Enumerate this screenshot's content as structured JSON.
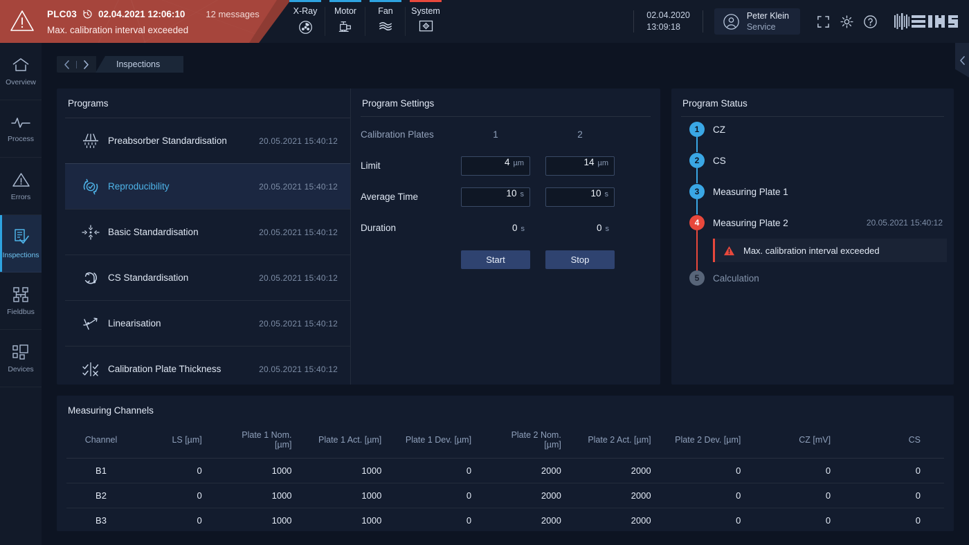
{
  "alarm": {
    "plc": "PLC03",
    "datetime": "02.04.2021 12:06:10",
    "messages": "12 messages",
    "text": "Max. calibration interval exceeded"
  },
  "status_tabs": [
    {
      "label": "X-Ray",
      "icon": "radiation-icon",
      "state_color": "#2ea3e0"
    },
    {
      "label": "Motor",
      "icon": "motor-icon",
      "state_color": "#2ea3e0"
    },
    {
      "label": "Fan",
      "icon": "fan-icon",
      "state_color": "#2ea3e0"
    },
    {
      "label": "System",
      "icon": "system-gear-icon",
      "state_color": "#e8483c"
    }
  ],
  "header": {
    "date": "02.04.2020",
    "time": "13:09:18",
    "user_name": "Peter Klein",
    "user_role": "Service",
    "fullscreen_icon": "fullscreen-icon",
    "settings_icon": "gear-icon",
    "help_icon": "help-icon",
    "logo": "IMS"
  },
  "sidebar": {
    "items": [
      {
        "label": "Overview",
        "icon": "home-icon",
        "active": false
      },
      {
        "label": "Process",
        "icon": "pulse-icon",
        "active": false
      },
      {
        "label": "Errors",
        "icon": "warning-icon",
        "active": false
      },
      {
        "label": "Inspections",
        "icon": "checklist-icon",
        "active": true
      },
      {
        "label": "Fieldbus",
        "icon": "network-icon",
        "active": false
      },
      {
        "label": "Devices",
        "icon": "devices-icon",
        "active": false
      }
    ]
  },
  "breadcrumb": {
    "back_icon": "chevron-left-icon",
    "forward_icon": "chevron-right-icon",
    "current": "Inspections"
  },
  "programs": {
    "title": "Programs",
    "items": [
      {
        "name": "Preabsorber Standardisation",
        "date": "20.05.2021  15:40:12",
        "icon": "preabsorber-icon",
        "selected": false
      },
      {
        "name": "Reproducibility",
        "date": "20.05.2021  15:40:12",
        "icon": "reproducibility-icon",
        "selected": true
      },
      {
        "name": "Basic Standardisation",
        "date": "20.05.2021  15:40:12",
        "icon": "basic-std-icon",
        "selected": false
      },
      {
        "name": "CS Standardisation",
        "date": "20.05.2021  15:40:12",
        "icon": "cs-std-icon",
        "selected": false
      },
      {
        "name": "Linearisation",
        "date": "20.05.2021  15:40:12",
        "icon": "linearisation-icon",
        "selected": false
      },
      {
        "name": "Calibration Plate Thickness",
        "date": "20.05.2021  15:40:12",
        "icon": "plate-thickness-icon",
        "selected": false
      }
    ]
  },
  "settings": {
    "title": "Program Settings",
    "plates_label": "Calibration Plates",
    "plate1_header": "1",
    "plate2_header": "2",
    "rows": [
      {
        "label": "Limit",
        "p1_value": "4",
        "p1_unit": "µm",
        "p2_value": "14",
        "p2_unit": "µm",
        "editable": true
      },
      {
        "label": "Average Time",
        "p1_value": "10",
        "p1_unit": "s",
        "p2_value": "10",
        "p2_unit": "s",
        "editable": true
      },
      {
        "label": "Duration",
        "p1_value": "0",
        "p1_unit": "s",
        "p2_value": "0",
        "p2_unit": "s",
        "editable": false
      }
    ],
    "start_label": "Start",
    "stop_label": "Stop"
  },
  "program_status": {
    "title": "Program Status",
    "steps": [
      {
        "num": "1",
        "label": "CZ",
        "date": "",
        "state": "done"
      },
      {
        "num": "2",
        "label": "CS",
        "date": "",
        "state": "done"
      },
      {
        "num": "3",
        "label": "Measuring Plate 1",
        "date": "",
        "state": "done"
      },
      {
        "num": "4",
        "label": "Measuring Plate 2",
        "date": "20.05.2021  15:40:12",
        "state": "err"
      },
      {
        "num": "5",
        "label": "Calculation",
        "date": "",
        "state": "todo"
      }
    ],
    "warning": {
      "icon": "warning-icon",
      "text": "Max. calibration interval exceeded"
    }
  },
  "channels": {
    "title": "Measuring Channels",
    "columns": [
      "Channel",
      "LS [µm]",
      "Plate 1 Nom. [µm]",
      "Plate 1 Act. [µm]",
      "Plate 1 Dev. [µm]",
      "Plate 2 Nom. [µm]",
      "Plate 2 Act. [µm]",
      "Plate 2 Dev. [µm]",
      "CZ [mV]",
      "CS"
    ],
    "rows": [
      [
        "B1",
        "0",
        "1000",
        "1000",
        "0",
        "2000",
        "2000",
        "0",
        "0",
        "0"
      ],
      [
        "B2",
        "0",
        "1000",
        "1000",
        "0",
        "2000",
        "2000",
        "0",
        "0",
        "0"
      ],
      [
        "B3",
        "0",
        "1000",
        "1000",
        "0",
        "2000",
        "2000",
        "0",
        "0",
        "0"
      ]
    ]
  },
  "colors": {
    "alarm_red": "#a6453c",
    "accent_blue": "#2ea3e0",
    "error_red": "#e8483c",
    "panel_bg": "#131c2e",
    "page_bg": "#0d1422"
  }
}
